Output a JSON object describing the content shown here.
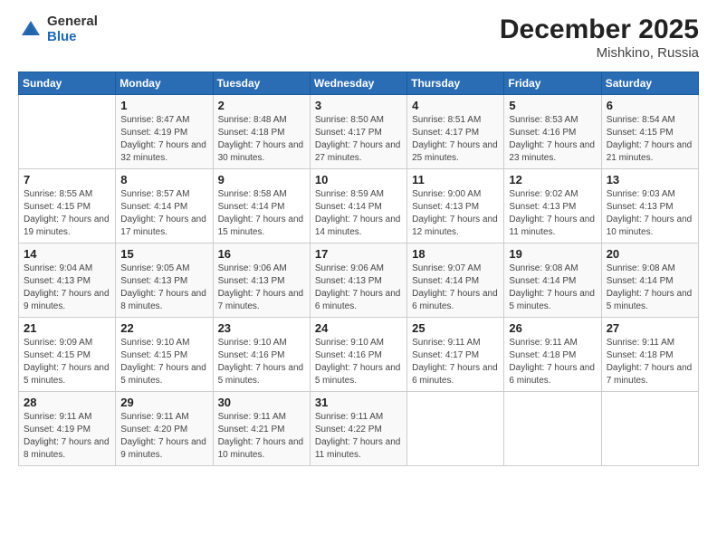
{
  "logo": {
    "general": "General",
    "blue": "Blue"
  },
  "title": "December 2025",
  "location": "Mishkino, Russia",
  "days_header": [
    "Sunday",
    "Monday",
    "Tuesday",
    "Wednesday",
    "Thursday",
    "Friday",
    "Saturday"
  ],
  "weeks": [
    [
      {
        "day": "",
        "sunrise": "",
        "sunset": "",
        "daylight": ""
      },
      {
        "day": "1",
        "sunrise": "Sunrise: 8:47 AM",
        "sunset": "Sunset: 4:19 PM",
        "daylight": "Daylight: 7 hours and 32 minutes."
      },
      {
        "day": "2",
        "sunrise": "Sunrise: 8:48 AM",
        "sunset": "Sunset: 4:18 PM",
        "daylight": "Daylight: 7 hours and 30 minutes."
      },
      {
        "day": "3",
        "sunrise": "Sunrise: 8:50 AM",
        "sunset": "Sunset: 4:17 PM",
        "daylight": "Daylight: 7 hours and 27 minutes."
      },
      {
        "day": "4",
        "sunrise": "Sunrise: 8:51 AM",
        "sunset": "Sunset: 4:17 PM",
        "daylight": "Daylight: 7 hours and 25 minutes."
      },
      {
        "day": "5",
        "sunrise": "Sunrise: 8:53 AM",
        "sunset": "Sunset: 4:16 PM",
        "daylight": "Daylight: 7 hours and 23 minutes."
      },
      {
        "day": "6",
        "sunrise": "Sunrise: 8:54 AM",
        "sunset": "Sunset: 4:15 PM",
        "daylight": "Daylight: 7 hours and 21 minutes."
      }
    ],
    [
      {
        "day": "7",
        "sunrise": "Sunrise: 8:55 AM",
        "sunset": "Sunset: 4:15 PM",
        "daylight": "Daylight: 7 hours and 19 minutes."
      },
      {
        "day": "8",
        "sunrise": "Sunrise: 8:57 AM",
        "sunset": "Sunset: 4:14 PM",
        "daylight": "Daylight: 7 hours and 17 minutes."
      },
      {
        "day": "9",
        "sunrise": "Sunrise: 8:58 AM",
        "sunset": "Sunset: 4:14 PM",
        "daylight": "Daylight: 7 hours and 15 minutes."
      },
      {
        "day": "10",
        "sunrise": "Sunrise: 8:59 AM",
        "sunset": "Sunset: 4:14 PM",
        "daylight": "Daylight: 7 hours and 14 minutes."
      },
      {
        "day": "11",
        "sunrise": "Sunrise: 9:00 AM",
        "sunset": "Sunset: 4:13 PM",
        "daylight": "Daylight: 7 hours and 12 minutes."
      },
      {
        "day": "12",
        "sunrise": "Sunrise: 9:02 AM",
        "sunset": "Sunset: 4:13 PM",
        "daylight": "Daylight: 7 hours and 11 minutes."
      },
      {
        "day": "13",
        "sunrise": "Sunrise: 9:03 AM",
        "sunset": "Sunset: 4:13 PM",
        "daylight": "Daylight: 7 hours and 10 minutes."
      }
    ],
    [
      {
        "day": "14",
        "sunrise": "Sunrise: 9:04 AM",
        "sunset": "Sunset: 4:13 PM",
        "daylight": "Daylight: 7 hours and 9 minutes."
      },
      {
        "day": "15",
        "sunrise": "Sunrise: 9:05 AM",
        "sunset": "Sunset: 4:13 PM",
        "daylight": "Daylight: 7 hours and 8 minutes."
      },
      {
        "day": "16",
        "sunrise": "Sunrise: 9:06 AM",
        "sunset": "Sunset: 4:13 PM",
        "daylight": "Daylight: 7 hours and 7 minutes."
      },
      {
        "day": "17",
        "sunrise": "Sunrise: 9:06 AM",
        "sunset": "Sunset: 4:13 PM",
        "daylight": "Daylight: 7 hours and 6 minutes."
      },
      {
        "day": "18",
        "sunrise": "Sunrise: 9:07 AM",
        "sunset": "Sunset: 4:14 PM",
        "daylight": "Daylight: 7 hours and 6 minutes."
      },
      {
        "day": "19",
        "sunrise": "Sunrise: 9:08 AM",
        "sunset": "Sunset: 4:14 PM",
        "daylight": "Daylight: 7 hours and 5 minutes."
      },
      {
        "day": "20",
        "sunrise": "Sunrise: 9:08 AM",
        "sunset": "Sunset: 4:14 PM",
        "daylight": "Daylight: 7 hours and 5 minutes."
      }
    ],
    [
      {
        "day": "21",
        "sunrise": "Sunrise: 9:09 AM",
        "sunset": "Sunset: 4:15 PM",
        "daylight": "Daylight: 7 hours and 5 minutes."
      },
      {
        "day": "22",
        "sunrise": "Sunrise: 9:10 AM",
        "sunset": "Sunset: 4:15 PM",
        "daylight": "Daylight: 7 hours and 5 minutes."
      },
      {
        "day": "23",
        "sunrise": "Sunrise: 9:10 AM",
        "sunset": "Sunset: 4:16 PM",
        "daylight": "Daylight: 7 hours and 5 minutes."
      },
      {
        "day": "24",
        "sunrise": "Sunrise: 9:10 AM",
        "sunset": "Sunset: 4:16 PM",
        "daylight": "Daylight: 7 hours and 5 minutes."
      },
      {
        "day": "25",
        "sunrise": "Sunrise: 9:11 AM",
        "sunset": "Sunset: 4:17 PM",
        "daylight": "Daylight: 7 hours and 6 minutes."
      },
      {
        "day": "26",
        "sunrise": "Sunrise: 9:11 AM",
        "sunset": "Sunset: 4:18 PM",
        "daylight": "Daylight: 7 hours and 6 minutes."
      },
      {
        "day": "27",
        "sunrise": "Sunrise: 9:11 AM",
        "sunset": "Sunset: 4:18 PM",
        "daylight": "Daylight: 7 hours and 7 minutes."
      }
    ],
    [
      {
        "day": "28",
        "sunrise": "Sunrise: 9:11 AM",
        "sunset": "Sunset: 4:19 PM",
        "daylight": "Daylight: 7 hours and 8 minutes."
      },
      {
        "day": "29",
        "sunrise": "Sunrise: 9:11 AM",
        "sunset": "Sunset: 4:20 PM",
        "daylight": "Daylight: 7 hours and 9 minutes."
      },
      {
        "day": "30",
        "sunrise": "Sunrise: 9:11 AM",
        "sunset": "Sunset: 4:21 PM",
        "daylight": "Daylight: 7 hours and 10 minutes."
      },
      {
        "day": "31",
        "sunrise": "Sunrise: 9:11 AM",
        "sunset": "Sunset: 4:22 PM",
        "daylight": "Daylight: 7 hours and 11 minutes."
      },
      {
        "day": "",
        "sunrise": "",
        "sunset": "",
        "daylight": ""
      },
      {
        "day": "",
        "sunrise": "",
        "sunset": "",
        "daylight": ""
      },
      {
        "day": "",
        "sunrise": "",
        "sunset": "",
        "daylight": ""
      }
    ]
  ]
}
